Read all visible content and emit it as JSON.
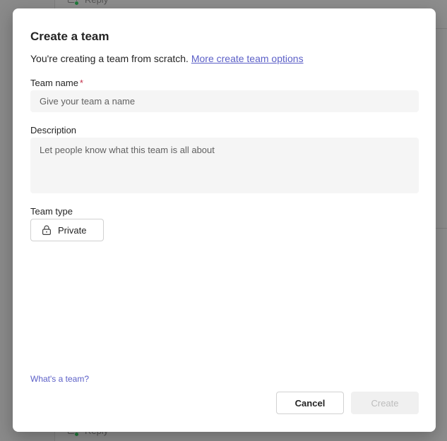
{
  "background": {
    "reply_label": "Reply"
  },
  "dialog": {
    "title": "Create a team",
    "subtitle": "You're creating a team from scratch.",
    "more_options_link": "More create team options",
    "team_name": {
      "label": "Team name",
      "required_marker": "*",
      "placeholder": "Give your team a name",
      "value": ""
    },
    "description": {
      "label": "Description",
      "placeholder": "Let people know what this team is all about",
      "value": ""
    },
    "team_type": {
      "label": "Team type",
      "selected": "Private",
      "icon": "lock-icon"
    },
    "help_link": "What's a team?",
    "cancel_label": "Cancel",
    "create_label": "Create"
  },
  "colors": {
    "accent": "#5b5fc7",
    "required": "#c4314b",
    "disabled_text": "#bdbdbd",
    "input_bg": "#f5f5f5"
  }
}
